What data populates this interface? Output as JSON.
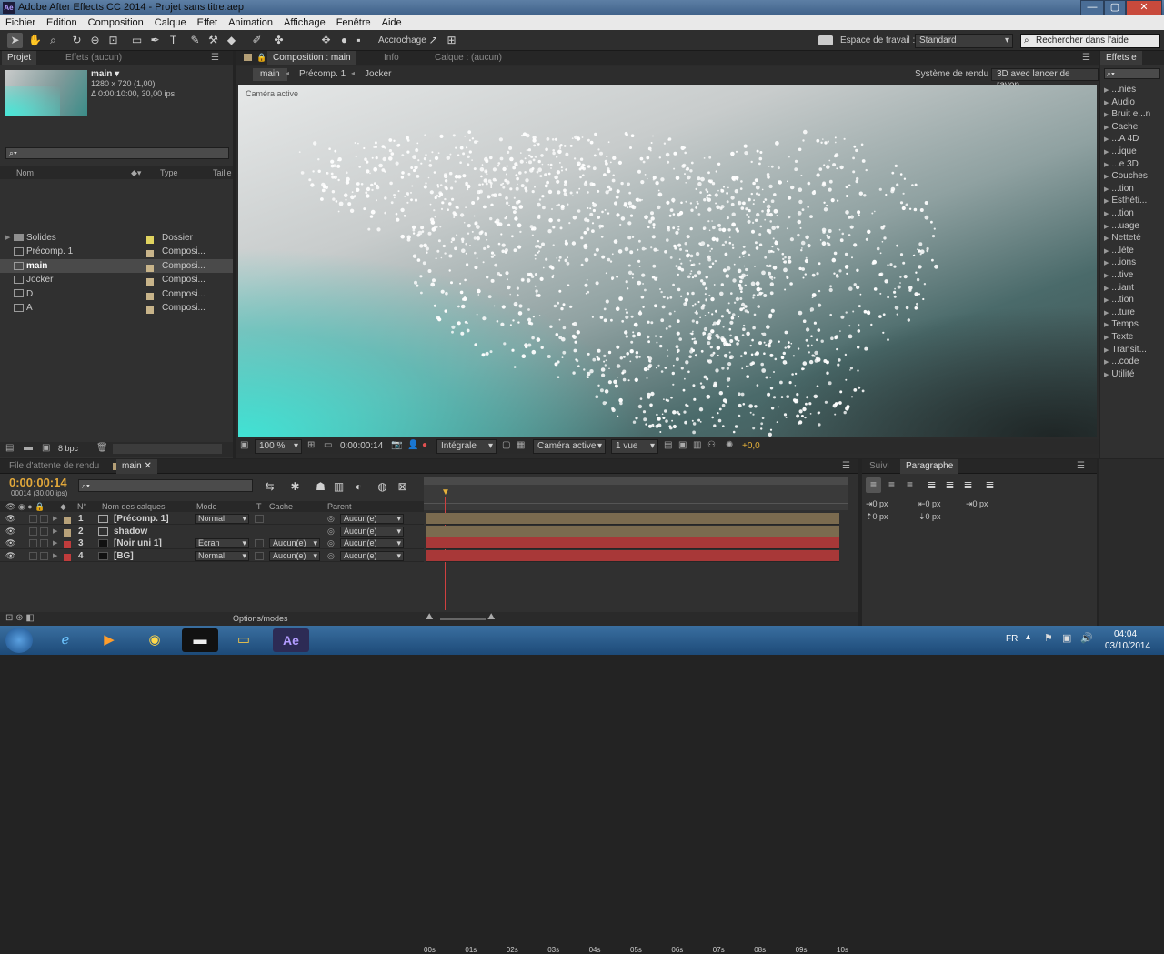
{
  "window": {
    "title": "Adobe After Effects CC 2014 - Projet sans titre.aep",
    "app_icon": "Ae",
    "min": "—",
    "max": "▢",
    "close": "✕"
  },
  "menu": [
    "Fichier",
    "Edition",
    "Composition",
    "Calque",
    "Effet",
    "Animation",
    "Affichage",
    "Fenêtre",
    "Aide"
  ],
  "toolbar": {
    "snap_label": "Accrochage",
    "workspace_label": "Espace de travail :",
    "workspace_value": "Standard",
    "help_placeholder": "Rechercher dans l'aide"
  },
  "project": {
    "tabs": [
      "Projet",
      "Effets (aucun)"
    ],
    "thumb_name": "main ▾",
    "thumb_size": "1280 x 720 (1,00)",
    "thumb_duration": "Δ 0:00:10:00, 30,00 ips",
    "search_placeholder": "⌕▾",
    "col_name": "Nom",
    "col_type": "Type",
    "col_size": "Taille",
    "items": [
      {
        "name": "Solides",
        "type": "Dossier",
        "color": "#e0d460",
        "kind": "folder"
      },
      {
        "name": "Précomp. 1",
        "type": "Composi...",
        "color": "#c8b48a",
        "kind": "comp"
      },
      {
        "name": "main",
        "type": "Composi...",
        "color": "#c8b48a",
        "kind": "comp"
      },
      {
        "name": "Jocker",
        "type": "Composi...",
        "color": "#c8b48a",
        "kind": "comp"
      },
      {
        "name": "D",
        "type": "Composi...",
        "color": "#c8b48a",
        "kind": "comp"
      },
      {
        "name": "A",
        "type": "Composi...",
        "color": "#c8b48a",
        "kind": "comp"
      }
    ],
    "bpc": "8 bpc"
  },
  "composition": {
    "tabs": [
      "Composition : main",
      "Info",
      "Calque : (aucun)"
    ],
    "breadcrumbs": [
      "main",
      "Précomp. 1",
      "Jocker"
    ],
    "renderer_label": "Système de rendu :",
    "renderer_value": "3D avec lancer de rayon",
    "camera_label": "Caméra active",
    "zoom": "100 %",
    "timecode": "0:00:00:14",
    "resolution": "Intégrale",
    "camera": "Caméra active",
    "views": "1 vue",
    "exposure": "+0,0"
  },
  "effects": {
    "title": "Effets e",
    "search": "⌕▾",
    "items": [
      "...nies",
      "Audio",
      "Bruit e...n",
      "Cache",
      "...A 4D",
      "...ique",
      "...e 3D",
      "Couches",
      "...tion",
      "Esthéti...",
      "...tion",
      "...uage",
      "Netteté",
      "...lète",
      "...ions",
      "...tive",
      "...iant",
      "...tion",
      "...ture",
      "Temps",
      "Texte",
      "Transit...",
      "...code",
      "Utilité"
    ]
  },
  "timeline": {
    "tabs": [
      "File d'attente de rendu",
      "main"
    ],
    "timecode": "0:00:00:14",
    "frame_info": "00014 (30.00 ips)",
    "search": "⌕▾",
    "col_num": "N°",
    "col_name": "Nom des calques",
    "col_mode": "Mode",
    "col_t": "T",
    "col_cache": "Cache",
    "col_parent": "Parent",
    "ruler": [
      "00s",
      "01s",
      "02s",
      "03s",
      "04s",
      "05s",
      "06s",
      "07s",
      "08s",
      "09s",
      "10s"
    ],
    "layers": [
      {
        "num": "1",
        "name": "[Précomp. 1]",
        "mode": "Normal",
        "cache": "",
        "parent": "Aucun(e)",
        "color": "#b8a27a",
        "bar": "#7b6b4f"
      },
      {
        "num": "2",
        "name": "shadow",
        "mode": "",
        "cache": "",
        "parent": "Aucun(e)",
        "color": "#b8a27a",
        "bar": "#7b6b4f"
      },
      {
        "num": "3",
        "name": "[Noir uni 1]",
        "mode": "Ecran",
        "cache": "Aucun(e)",
        "parent": "Aucun(e)",
        "color": "#c03c3c",
        "bar": "#a83838"
      },
      {
        "num": "4",
        "name": "[BG]",
        "mode": "Normal",
        "cache": "Aucun(e)",
        "parent": "Aucun(e)",
        "color": "#c03c3c",
        "bar": "#a83838"
      }
    ],
    "options": "Options/modes"
  },
  "side": {
    "tabs": [
      "Suivi",
      "Paragraphe"
    ],
    "px": [
      "0 px",
      "0 px",
      "0 px",
      "0 px",
      "0 px"
    ]
  },
  "taskbar": {
    "lang": "FR",
    "time": "04:04",
    "date": "03/10/2014",
    "ae": "Ae"
  }
}
